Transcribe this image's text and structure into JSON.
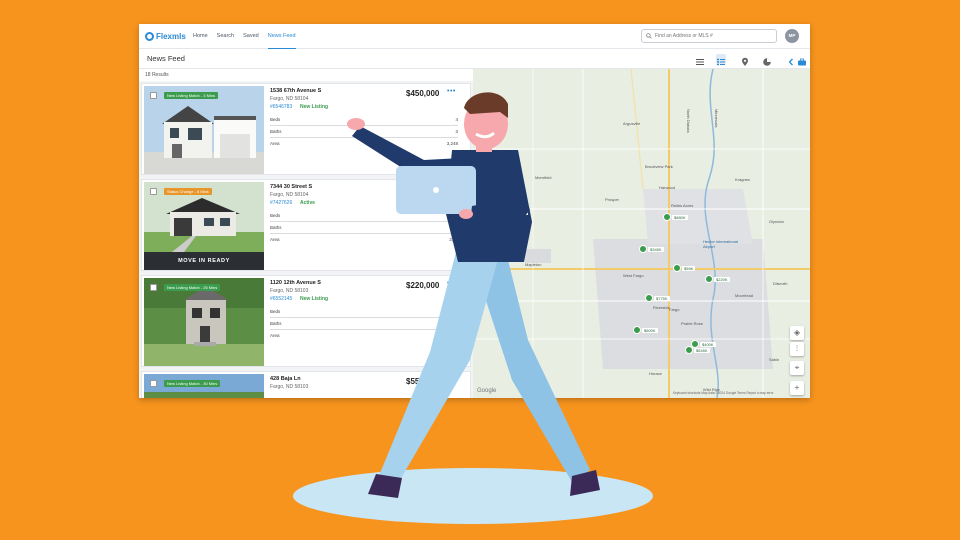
{
  "app": {
    "name": "Flexmls"
  },
  "nav": {
    "items": [
      "Home",
      "Search",
      "Saved",
      "News Feed"
    ]
  },
  "search": {
    "placeholder": "Find an Address or MLS #"
  },
  "user": {
    "initials": "MP"
  },
  "page": {
    "title": "News Feed",
    "results": "18 Results"
  },
  "listings": [
    {
      "badge": "New Listing Match - 3 Mins",
      "badge_color": "#3a9c4c",
      "address": "1538 67th Avenue S",
      "city": "Fargo, ND 58104",
      "mls": "#6546783",
      "status": "New Listing",
      "price": "$450,000",
      "beds_label": "Beds",
      "beds": "4",
      "baths_label": "Baths",
      "baths": "3",
      "area_label": "Area",
      "area": "3,248"
    },
    {
      "badge": "Status Change - 6 Mins",
      "badge_color": "#e8952a",
      "address": "7344 30 Street S",
      "city": "Fargo, ND 58104",
      "mls": "#7427626",
      "status": "Active",
      "price": "",
      "banner": "MOVE IN READY",
      "beds_label": "Beds",
      "beds": "",
      "baths_label": "Baths",
      "baths": "",
      "area_label": "Area",
      "area": "3,20"
    },
    {
      "badge": "New Listing Match - 25 Mins",
      "badge_color": "#3a9c4c",
      "address": "1120 12th Avenue S",
      "city": "Fargo, ND 58103",
      "mls": "#6552145",
      "status": "New Listing",
      "price": "$220,000",
      "beds_label": "Beds",
      "beds": "",
      "baths_label": "Baths",
      "baths": "",
      "area_label": "Area",
      "area": ""
    },
    {
      "badge": "New Listing Match - 30 Mins",
      "badge_color": "#3a9c4c",
      "address": "428 Baja Ln",
      "city": "Fargo, ND 58103",
      "mls": "",
      "status": "",
      "price": "$55"
    }
  ],
  "map": {
    "towns": [
      "Argusville",
      "Brookview Park",
      "Harwood",
      "Kragnes",
      "Glyndon",
      "Reiles Acres",
      "Hector International Airport",
      "Mapleton",
      "West Fargo",
      "Moorhead",
      "Fargo",
      "Prairie Rose",
      "Horace",
      "Wild Rice",
      "Sabin",
      "Dilworth",
      "Riverside",
      "North Dakota",
      "Minnesota",
      "Prosper",
      "Mernfield"
    ],
    "prices": [
      "$880K",
      "$345K",
      "$55K",
      "$220K",
      "$775K",
      "$600K",
      "$400K",
      "$545K"
    ],
    "attribution": "Google",
    "footer": "Keyboard shortcuts   Map data ©2024 Google   Terms   Report a map error"
  }
}
